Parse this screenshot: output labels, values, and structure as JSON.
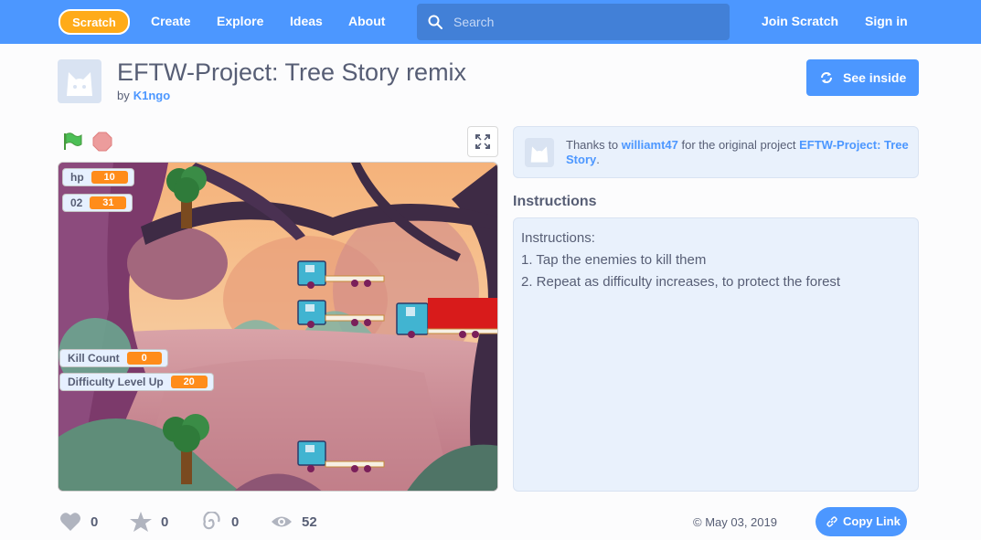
{
  "nav": {
    "logo": "Scratch",
    "links": [
      "Create",
      "Explore",
      "Ideas",
      "About"
    ],
    "search_placeholder": "Search",
    "join": "Join Scratch",
    "sign_in": "Sign in"
  },
  "project": {
    "title": "EFTW-Project: Tree Story remix",
    "by": "by",
    "author": "K1ngo",
    "see_inside": "See inside"
  },
  "stage": {
    "monitors": [
      {
        "label": "hp",
        "value": "10"
      },
      {
        "label": "02",
        "value": "31"
      },
      {
        "label": "Kill Count",
        "value": "0"
      },
      {
        "label": "Difficulty Level Up",
        "value": "20"
      }
    ]
  },
  "credits": {
    "prefix": "Thanks to",
    "user": "williamt47",
    "middle": "for the original project",
    "project": "EFTW-Project: Tree Story",
    "suffix": "."
  },
  "instructions": {
    "heading": "Instructions",
    "lines": [
      "Instructions:",
      "1. Tap the enemies to kill them",
      "2. Repeat as difficulty increases, to protect the forest"
    ]
  },
  "stats": {
    "loves": "0",
    "favorites": "0",
    "remixes": "0",
    "views": "52"
  },
  "date": "© May 03, 2019",
  "copy_link": "Copy Link",
  "colors": {
    "nav": "#4c97ff",
    "accent": "#4c97ff",
    "monitor_value": "#ff8c1a",
    "panel": "#e9f1fc"
  },
  "icons": {
    "flag": "green-flag-icon",
    "stop": "stop-icon",
    "fullscreen": "fullscreen-icon",
    "love": "heart-icon",
    "favorite": "star-icon",
    "remix": "remix-icon",
    "views": "eye-icon",
    "link": "link-icon"
  }
}
